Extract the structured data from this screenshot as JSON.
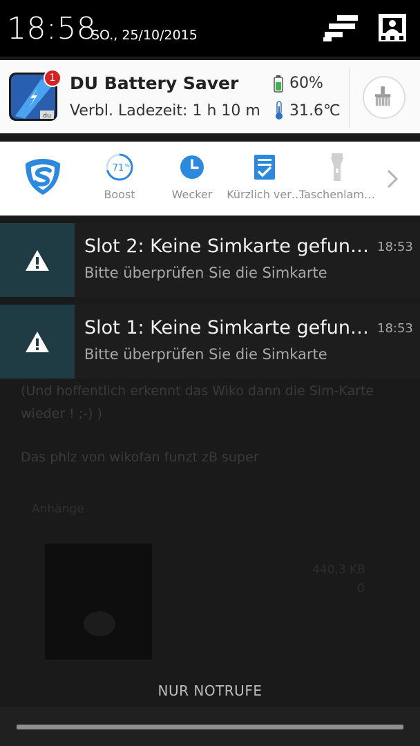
{
  "status_bar": {
    "time": "18:58",
    "date": "SO., 25/10/2015"
  },
  "du_battery_saver": {
    "title": "DU Battery Saver",
    "subtitle": "Verbl. Ladezeit: 1 h 10 m",
    "battery_level": "60%",
    "temperature": "31.6℃",
    "badge_count": "1",
    "logo_text": "du"
  },
  "toolbar": {
    "boost_percent": "71",
    "boost_percent_sign": "%",
    "items": [
      {
        "label": "Boost",
        "icon": "boost-ring-icon"
      },
      {
        "label": "Wecker",
        "icon": "clock-icon"
      },
      {
        "label": "Kürzlich ver…",
        "icon": "checklist-icon"
      },
      {
        "label": "Taschenlam…",
        "icon": "flashlight-icon"
      }
    ]
  },
  "notifications": [
    {
      "title": "Slot 2: Keine Simkarte gefun…",
      "text": "Bitte überprüfen Sie die Simkarte",
      "time": "18:53",
      "icon": "warning-icon"
    },
    {
      "title": "Slot 1: Keine Simkarte gefun…",
      "text": "Bitte überprüfen Sie die Simkarte",
      "time": "18:53",
      "icon": "warning-icon"
    }
  ],
  "background_page": {
    "line1": "(Und hoffentlich erkennt das Wiko dann die Sim-Karte",
    "line2": "wieder ! ;-) )",
    "line3": "Das phlz von wikofan funzt zB super",
    "attachments_label": "Anhänge",
    "file_size": "440,3 KB",
    "count": "0"
  },
  "emergency_label": "NUR NOTRUFE",
  "colors": {
    "accent_blue": "#2b8ae0",
    "warning_bg": "#1f3b44",
    "badge_red": "#d82020",
    "battery_green": "#3cb44a"
  }
}
